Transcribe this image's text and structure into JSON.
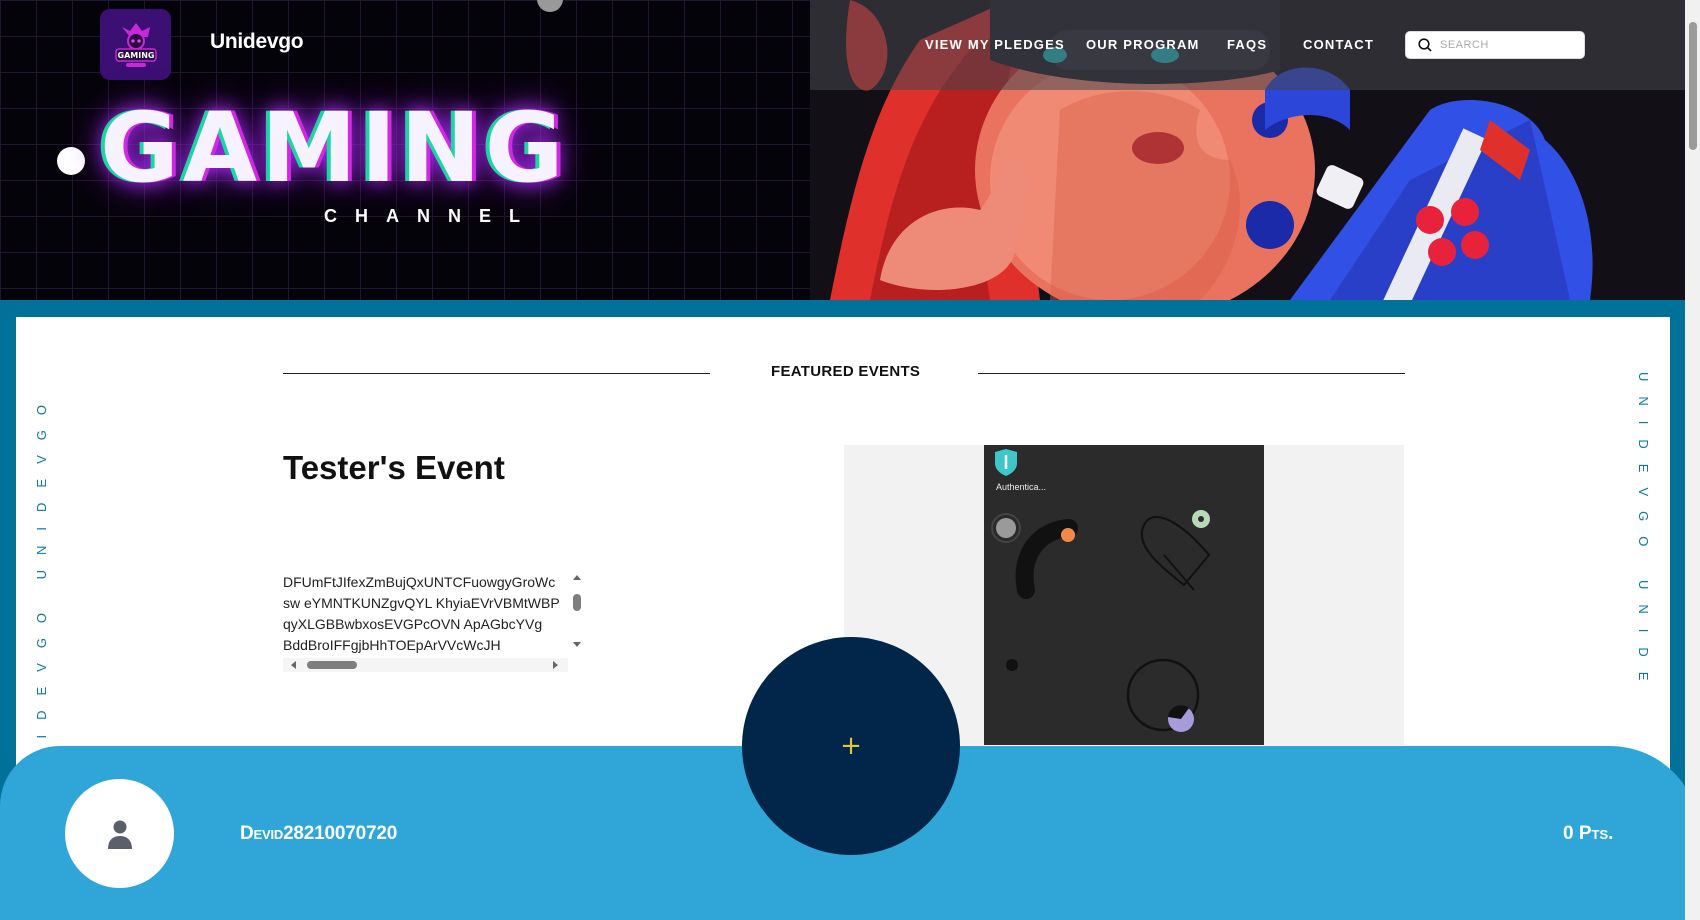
{
  "header": {
    "brand": "Unidevgo",
    "logo_text": "GAMING",
    "nav": [
      "VIEW MY PLEDGES",
      "OUR PROGRAM",
      "FAQS",
      "CONTACT"
    ],
    "search_placeholder": "SEARCH"
  },
  "hero": {
    "title": "GAMING",
    "subtitle": "CHANNEL"
  },
  "side_text": {
    "left": "UNIDEVGO UNIDEVGO",
    "right": "UNIDEVGO UNIDE"
  },
  "section": {
    "heading": "FEATURED EVENTS"
  },
  "event": {
    "title": "Tester's Event",
    "description_lines": [
      "DFUmFtJIfexZmBujQxUNTCFuowgyGroWc",
      "sw eYMNTKUNZgvQYL KhyiaEVrVBMtWBP",
      "qyXLGBBwbxosEVGPcOVN ApAGbcYVg",
      "BddBroIFFgjbHhTOEpArVVcWcJH"
    ],
    "media_label": "Authentica..."
  },
  "user": {
    "name": "Devid28210070720",
    "points": "0 Pts."
  },
  "fab_symbol": "+",
  "colors": {
    "frame": "#00729a",
    "bottom_bar": "#2fa6d7",
    "fab": "#02254a",
    "accent_gold": "#e6c23c"
  }
}
